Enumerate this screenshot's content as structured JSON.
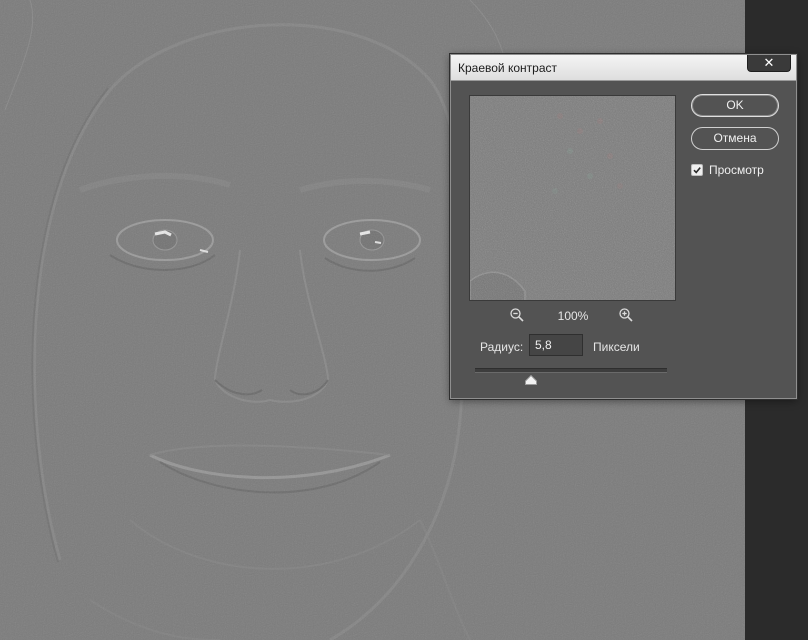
{
  "dialog": {
    "title": "Краевой контраст",
    "close_icon": "close-icon",
    "ok_label": "OK",
    "cancel_label": "Отмена",
    "preview_label": "Просмотр",
    "preview_checked": true,
    "zoom": {
      "value": "100%",
      "zoom_out_icon": "zoom-out-icon",
      "zoom_in_icon": "zoom-in-icon"
    },
    "radius": {
      "label": "Радиус:",
      "value": "5,8",
      "units": "Пиксели",
      "slider_fraction": 0.29
    }
  },
  "colors": {
    "canvas_gray": "#7b7b7b",
    "dialog_bg": "#535353",
    "titlebar": "#e8e8e8",
    "close_button": "#3a3a3a"
  }
}
